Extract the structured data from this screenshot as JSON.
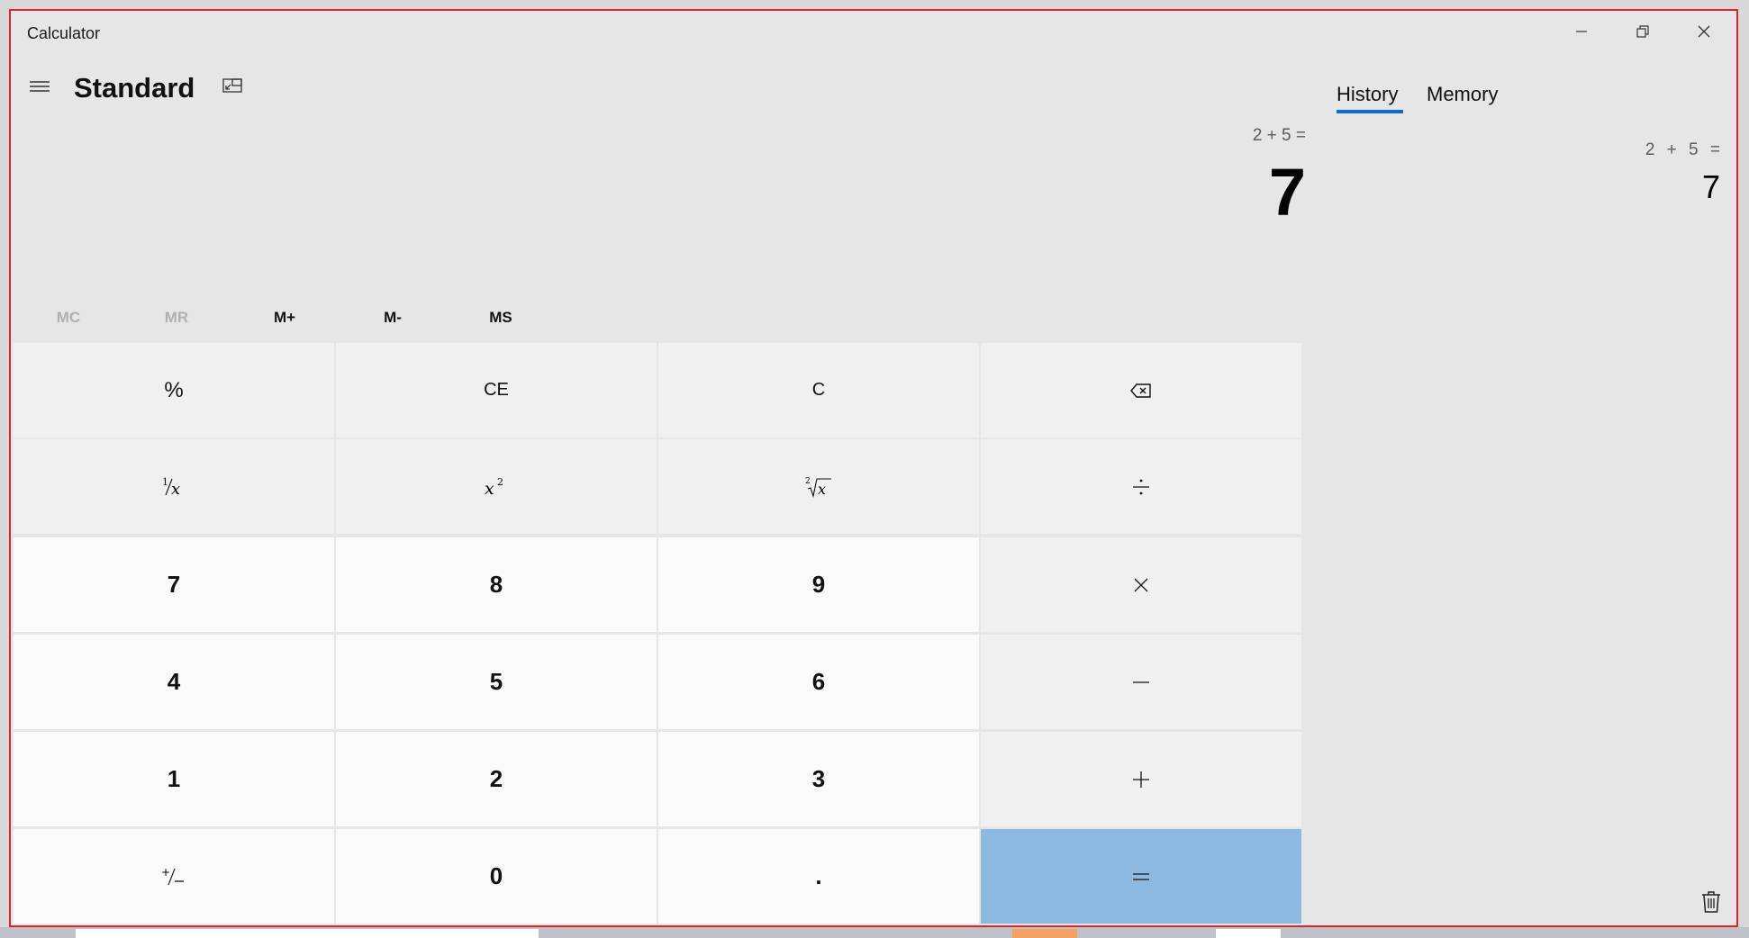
{
  "window": {
    "title": "Calculator"
  },
  "header": {
    "mode": "Standard"
  },
  "display": {
    "expression": "2 + 5 =",
    "value": "7"
  },
  "memory": {
    "mc": "MC",
    "mr": "MR",
    "mplus": "M+",
    "mminus": "M-",
    "ms": "MS"
  },
  "keys": {
    "percent": "%",
    "ce": "CE",
    "c": "C",
    "seven": "7",
    "eight": "8",
    "nine": "9",
    "four": "4",
    "five": "5",
    "six": "6",
    "one": "1",
    "two": "2",
    "three": "3",
    "zero": "0",
    "decimal": "."
  },
  "sidepanel": {
    "tabs": [
      "History",
      "Memory"
    ],
    "history": [
      {
        "expression": "2 + 5 =",
        "value": "7"
      }
    ]
  },
  "colors": {
    "accent": "#0b6cd1",
    "equals_bg": "#8cb9e0",
    "window_border": "#d6262b"
  }
}
